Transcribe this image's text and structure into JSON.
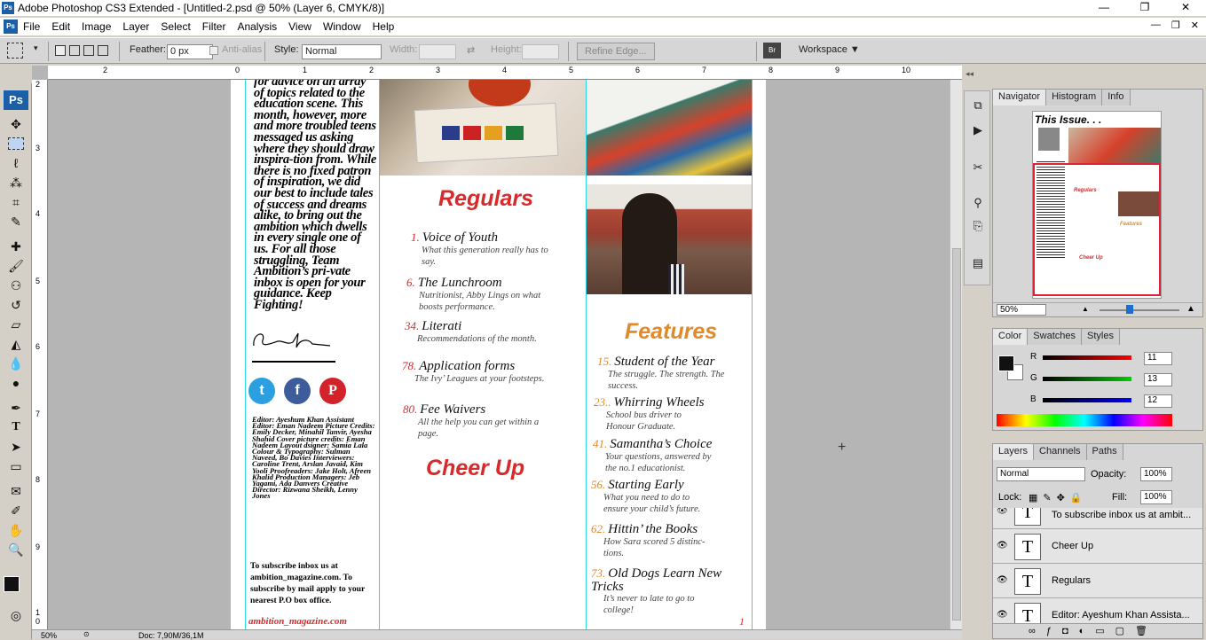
{
  "titlebar": {
    "title": "Adobe Photoshop CS3 Extended - [Untitled-2.psd @ 50% (Layer 6, CMYK/8)]",
    "app_icon": "Ps",
    "minimize": "—",
    "restore": "❐",
    "close": "✕"
  },
  "menu": {
    "icon": "Ps",
    "items": [
      "File",
      "Edit",
      "Image",
      "Layer",
      "Select",
      "Filter",
      "Analysis",
      "View",
      "Window",
      "Help"
    ],
    "mdi": [
      "—",
      "❐",
      "✕"
    ]
  },
  "options": {
    "feather_label": "Feather:",
    "feather_value": "0 px",
    "antialias": "Anti-alias",
    "style_label": "Style:",
    "style_value": "Normal",
    "width_label": "Width:",
    "height_label": "Height:",
    "refine": "Refine Edge...",
    "workspace": "Workspace ▼"
  },
  "rulers": {
    "h": [
      "2",
      "0",
      "1",
      "2",
      "3",
      "4",
      "5",
      "6",
      "7",
      "8",
      "9",
      "10"
    ],
    "v": [
      "2",
      "3",
      "4",
      "5",
      "6",
      "7",
      "8",
      "9",
      "1 0",
      "1 1"
    ]
  },
  "doc": {
    "col1": {
      "body": "for advice on an array of topics related to the education scene. This month, however, more and more troubled teens messaged us asking where they should draw inspira-tion from. While there is no fixed patron of inspiration, we did our best to include tales of success and dreams alike, to bring out the ambition which dwells in every single one of us. For all those struggling, Team Ambition’s pri-vate inbox is open for your guidance. Keep Fighting!",
      "social": [
        "t",
        "f",
        "P"
      ],
      "credits": "Editor: Ayeshum Khan Assistant Editor: Eman Nadeem Picture Credits: Emily Decker, Minahil Tanvir, Ayesha Shahid Cover picture credits: Eman Nadeem Layout dsigner: Samia Lala Colour & Typography: Sulman Naveed, Bo Davies Interviewers: Caroline Trent, Arslan Javaid, Kim Yooli Proofreaders: Jake Holt, Afreen Khalid Production Managers: Jeb Yagami, Ada Danvers Creative Director: Rizwana Sheikh, Lenny Jones",
      "subscribe": "To subscribe inbox us at ambition_magazine.com. To subscribe by mail apply to your nearest P.O box office.",
      "site": "ambition_magazine.com"
    },
    "regulars": {
      "heading": "Regulars",
      "items": [
        {
          "num": "1.",
          "title": "Voice of Youth",
          "desc": "What this generation really has to say."
        },
        {
          "num": "6.",
          "title": "The Lunchroom",
          "desc": "Nutritionist, Abby Lings on what boosts performance."
        },
        {
          "num": "34.",
          "title": "Literati",
          "desc": "Recommendations of the month."
        },
        {
          "num": "78.",
          "title": "Application forms",
          "desc": "The Ivy’ Leagues at your footsteps."
        },
        {
          "num": "80.",
          "title": "Fee Waivers",
          "desc": "All the help you can get within a page."
        }
      ]
    },
    "cheer_up": "Cheer Up",
    "features": {
      "heading": "Features",
      "items": [
        {
          "num": "15.",
          "title": "Student of the Year",
          "desc": "The struggle. The strength. The success."
        },
        {
          "num": "23..",
          "title": "Whirring Wheels",
          "desc": "School bus driver to Honour Graduate."
        },
        {
          "num": "41.",
          "title": "Samantha’s Choice",
          "desc": "Your questions, answered by the no.1 educationist."
        },
        {
          "num": "56.",
          "title": "Starting Early",
          "desc": "What you need to do to ensure your child’s future."
        },
        {
          "num": "62.",
          "title": "Hittin’ the Books",
          "desc": "How Sara scored 5 distinc-tions."
        },
        {
          "num": "73.",
          "title": "Old Dogs Learn New Tricks",
          "desc": "It’s never to late to go to college!"
        }
      ]
    },
    "page_num": "1"
  },
  "navigator": {
    "tabs": [
      "Navigator",
      "Histogram",
      "Info"
    ],
    "zoom": "50%",
    "thumb_title": "This Issue. . ."
  },
  "color": {
    "tabs": [
      "Color",
      "Swatches",
      "Styles"
    ],
    "r_label": "R",
    "r": "11",
    "g_label": "G",
    "g": "13",
    "b_label": "B",
    "b": "12"
  },
  "layers": {
    "tabs": [
      "Layers",
      "Channels",
      "Paths"
    ],
    "blend": "Normal",
    "opacity_label": "Opacity:",
    "opacity": "100%",
    "lock_label": "Lock:",
    "fill_label": "Fill:",
    "fill": "100%",
    "rows": [
      "To subscribe inbox us at ambit...",
      "Cheer Up",
      "Regulars",
      "Editor: Ayeshum Khan Assista..."
    ]
  },
  "status": {
    "zoom": "50%",
    "doc": "Doc: 7,90M/36,1M"
  },
  "colors": {
    "red": "#d82a2a",
    "orange": "#e08a2a",
    "guide": "#2cd5e8"
  }
}
